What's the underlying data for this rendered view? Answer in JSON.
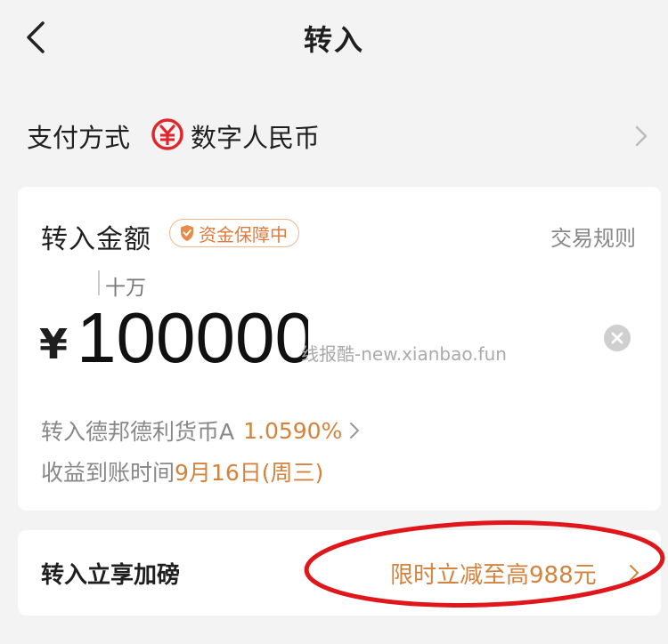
{
  "header": {
    "title": "转入"
  },
  "payment": {
    "label": "支付方式",
    "value": "数字人民币"
  },
  "amount_card": {
    "label": "转入金额",
    "badge": "资金保障中",
    "rules_link": "交易规则",
    "unit_hint": "十万",
    "currency_symbol": "¥",
    "amount_value": "100000",
    "watermark": "线报酷-new.xianbao.fun",
    "fund_prefix": "转入德邦德利货币A",
    "fund_rate": "1.0590%",
    "income_prefix": "收益到账时间",
    "income_date": "9月16日(周三)"
  },
  "promo": {
    "label": "转入立享加磅",
    "value": "限时立减至高988元"
  },
  "colors": {
    "accent": "#d3833d",
    "annotation": "#e0161b",
    "background": "#f3f3f3"
  },
  "icons": [
    "back-icon",
    "digital-rmb-icon",
    "chevron-right-icon",
    "shield-icon",
    "clear-icon"
  ]
}
